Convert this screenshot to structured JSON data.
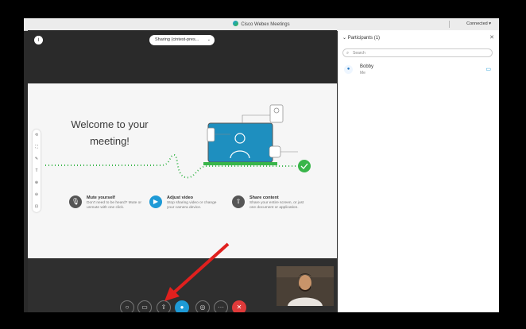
{
  "window": {
    "title": "Cisco Webex Meetings",
    "status": "Connected"
  },
  "meeting": {
    "share_label": "Sharing (cintest-pres...",
    "welcome_text": "Welcome to your meeting!",
    "features": [
      {
        "title": "Mute yourself",
        "desc": "Don't need to be heard? Mute or unmute with one click.",
        "color": "#555555",
        "icon": "microphone-icon"
      },
      {
        "title": "Adjust video",
        "desc": "Stop sharing video or change your camera device.",
        "color": "#1e9ad6",
        "icon": "camera-icon"
      },
      {
        "title": "Share content",
        "desc": "Share your entire screen, or just one document or application.",
        "color": "#555555",
        "icon": "share-icon"
      }
    ]
  },
  "controls": [
    {
      "name": "mute-button",
      "glyph": "○",
      "color": "#2f2f2f"
    },
    {
      "name": "video-button",
      "glyph": "▭",
      "color": "#2f2f2f"
    },
    {
      "name": "share-button",
      "glyph": "⇪",
      "color": "#2f2f2f"
    },
    {
      "name": "participants-button",
      "glyph": "●",
      "color": "#1e9ad6"
    },
    {
      "name": "record-button",
      "glyph": "◎",
      "color": "#2f2f2f"
    },
    {
      "name": "more-button",
      "glyph": "···",
      "color": "#2f2f2f"
    },
    {
      "name": "leave-button",
      "glyph": "✕",
      "color": "#e03a3a"
    }
  ],
  "participants": {
    "header": "Participants (1)",
    "search_placeholder": "Search",
    "list": [
      {
        "name": "Bobby",
        "sub": "Me"
      }
    ]
  }
}
